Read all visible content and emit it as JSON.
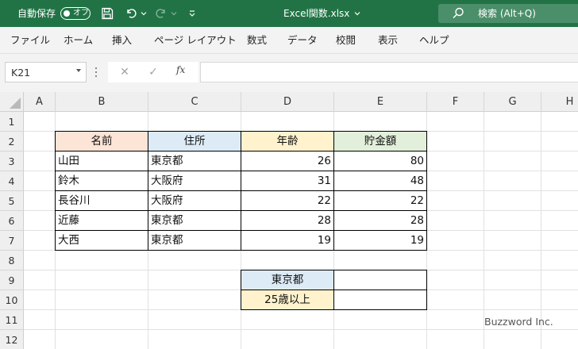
{
  "titlebar": {
    "autosave_label": "自動保存",
    "autosave_state": "オフ",
    "filename": "Excel関数.xlsx",
    "search_text": "検索 (Alt+Q)",
    "accent_color": "#217346"
  },
  "ribbon": {
    "tabs": [
      "ファイル",
      "ホーム",
      "挿入",
      "ページ レイアウト",
      "数式",
      "データ",
      "校閲",
      "表示",
      "ヘルプ"
    ]
  },
  "formula_bar": {
    "name_box": "K21",
    "fx_label": "fx",
    "formula": ""
  },
  "sheet": {
    "columns": [
      "A",
      "B",
      "C",
      "D",
      "E",
      "F",
      "G",
      "H"
    ],
    "rows": [
      "1",
      "2",
      "3",
      "4",
      "5",
      "6",
      "7",
      "8",
      "9",
      "10",
      "11",
      "12"
    ],
    "table": {
      "headers": [
        "名前",
        "住所",
        "年齢",
        "貯金額"
      ],
      "header_colors": [
        "#fce4d6",
        "#ddebf7",
        "#fff2cc",
        "#e2efda"
      ],
      "rows": [
        [
          "山田",
          "東京都",
          "26",
          "80"
        ],
        [
          "鈴木",
          "大阪府",
          "31",
          "48"
        ],
        [
          "長谷川",
          "大阪府",
          "22",
          "22"
        ],
        [
          "近藤",
          "東京都",
          "28",
          "28"
        ],
        [
          "大西",
          "東京都",
          "19",
          "19"
        ]
      ]
    },
    "criteria": [
      {
        "label": "東京都",
        "value": "",
        "color": "#ddebf7"
      },
      {
        "label": "25歳以上",
        "value": "",
        "color": "#fff2cc"
      }
    ]
  },
  "watermark": "Buzzword Inc."
}
